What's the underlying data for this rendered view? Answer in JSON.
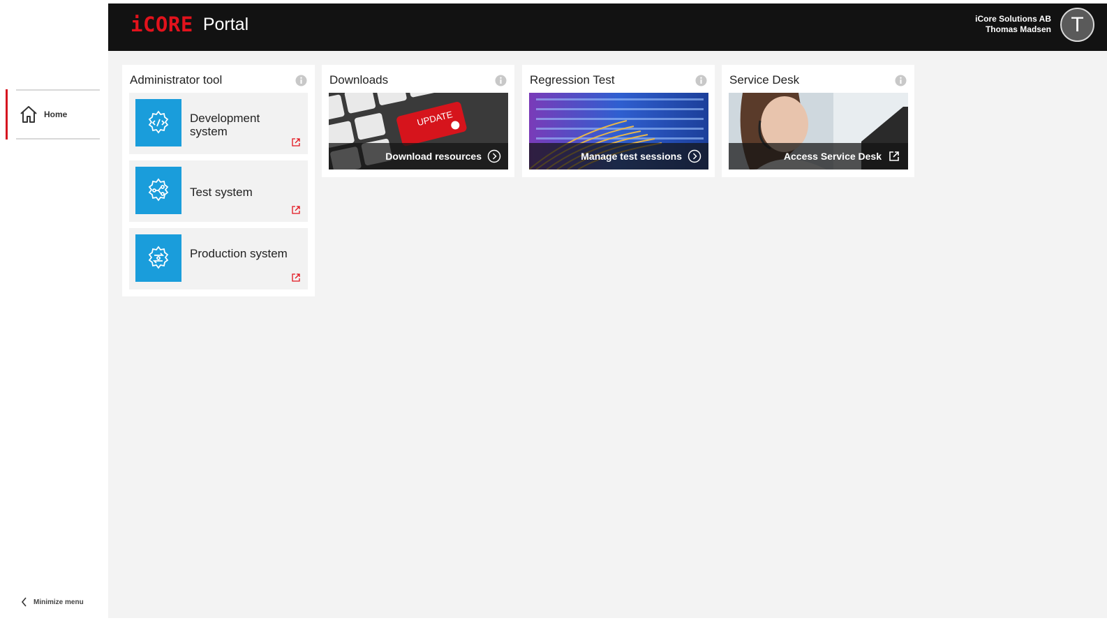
{
  "sidebar": {
    "items": [
      {
        "label": "Home",
        "icon": "home-icon",
        "active": true
      }
    ],
    "minimize_label": "Minimize menu"
  },
  "header": {
    "logo": "iCORE",
    "title": "Portal",
    "company": "iCore Solutions AB",
    "user": "Thomas Madsen",
    "avatar_initial": "T"
  },
  "cards": {
    "admin": {
      "title": "Administrator tool",
      "systems": [
        {
          "label": "Development system",
          "icon": "code-gear-icon"
        },
        {
          "label": "Test system",
          "icon": "flow-gear-icon"
        },
        {
          "label": "Production system",
          "icon": "swap-gear-icon"
        }
      ]
    },
    "downloads": {
      "title": "Downloads",
      "link": "Download resources",
      "keyboard_text": "UPDATE"
    },
    "regression": {
      "title": "Regression Test",
      "link": "Manage test sessions"
    },
    "servicedesk": {
      "title": "Service Desk",
      "link": "Access Service Desk"
    }
  },
  "colors": {
    "accent": "#e2121c",
    "tile_blue": "#1a9ddb",
    "header_bg": "#121212"
  }
}
